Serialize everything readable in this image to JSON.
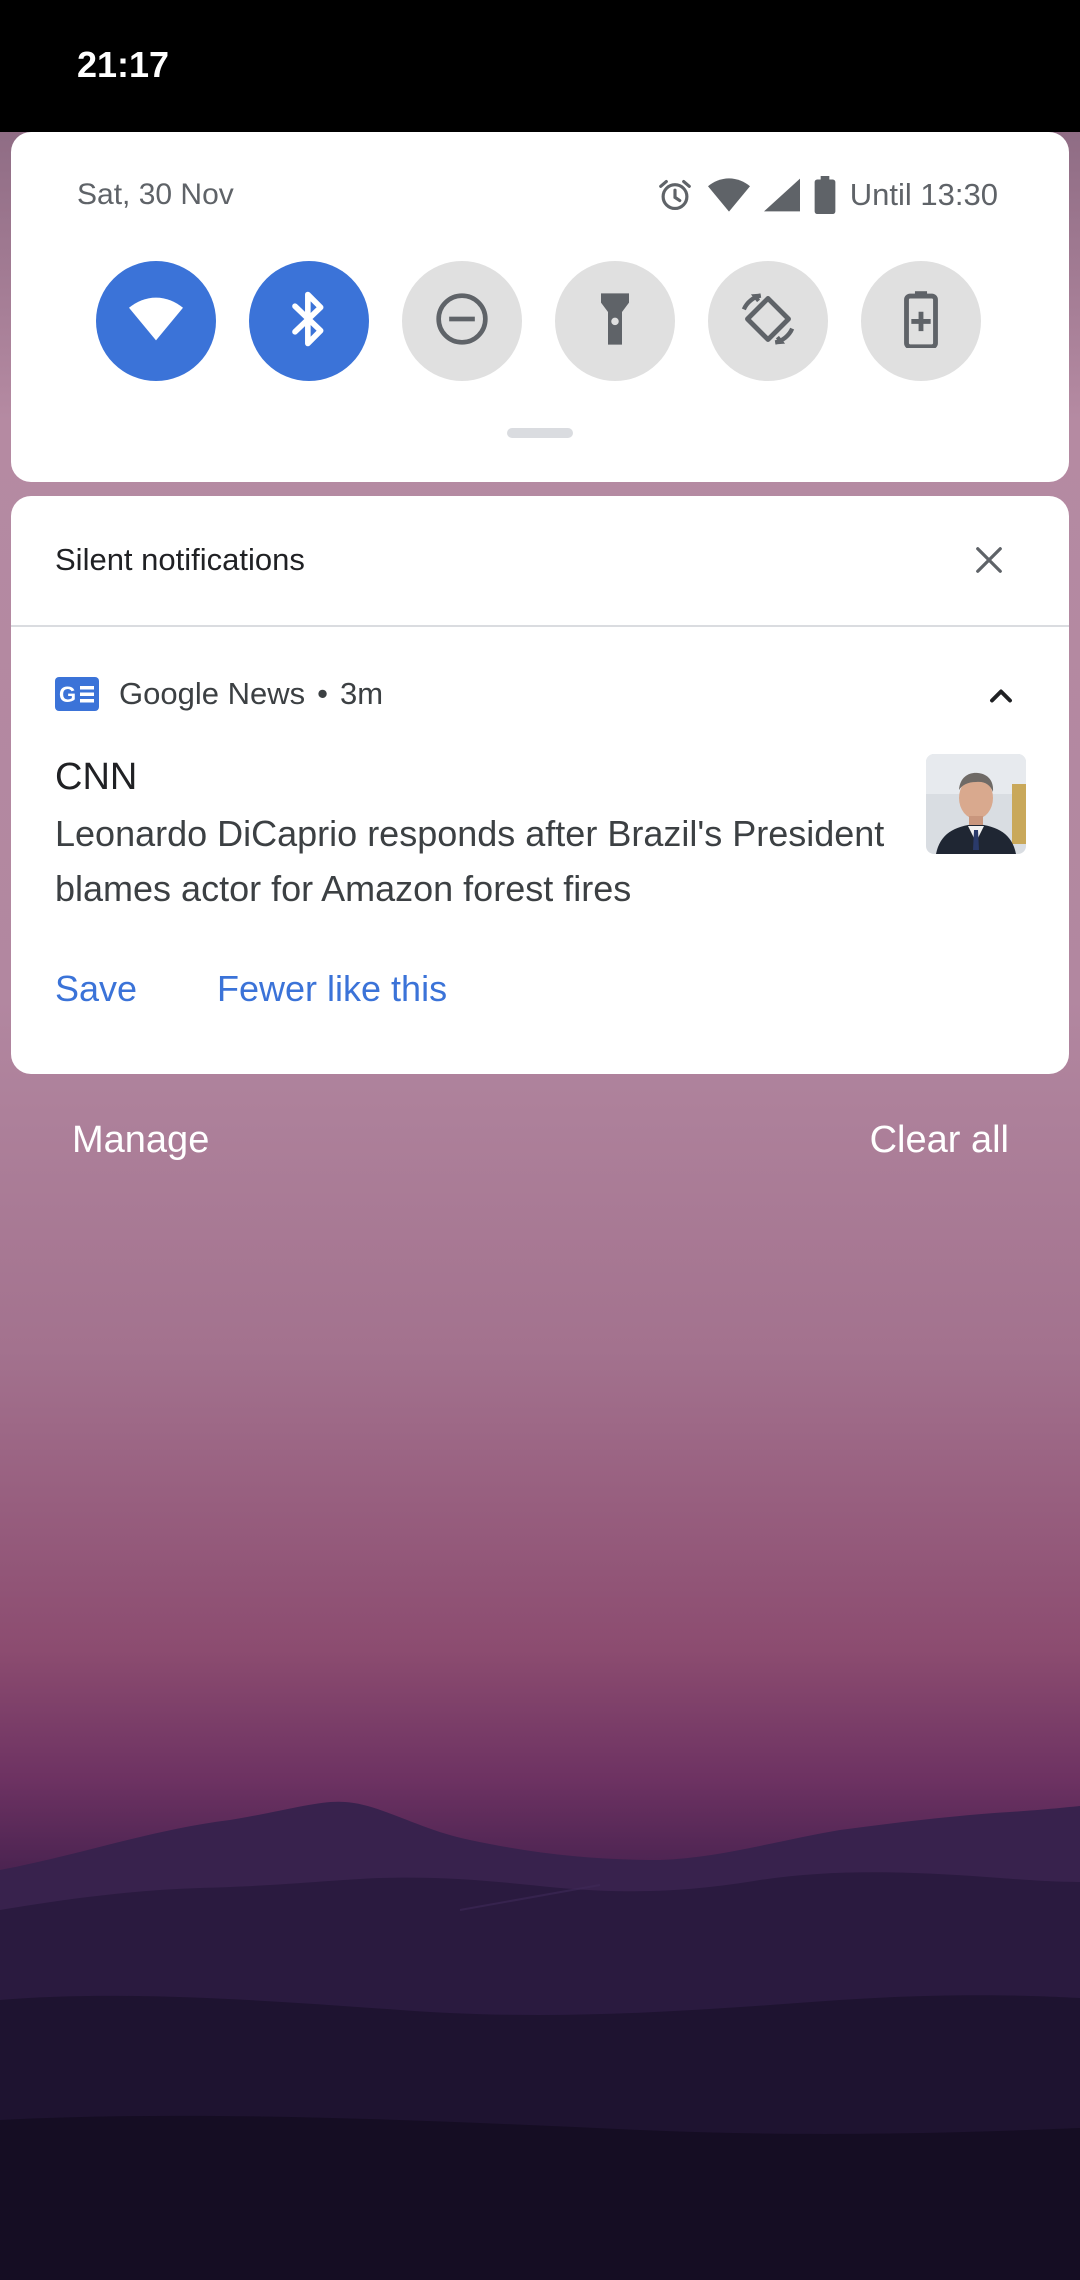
{
  "status_bar": {
    "time": "21:17"
  },
  "quick_settings": {
    "date": "Sat, 30 Nov",
    "battery_text": "Until 13:30",
    "tiles": [
      {
        "id": "wifi",
        "active": true
      },
      {
        "id": "bluetooth",
        "active": true
      },
      {
        "id": "do-not-disturb",
        "active": false
      },
      {
        "id": "flashlight",
        "active": false
      },
      {
        "id": "auto-rotate",
        "active": false
      },
      {
        "id": "battery-saver",
        "active": false
      }
    ]
  },
  "notifications": {
    "section_title": "Silent notifications",
    "items": [
      {
        "app_name": "Google News",
        "separator": "•",
        "time": "3m",
        "title": "CNN",
        "body": "Leonardo DiCaprio responds after Brazil's President blames actor for Amazon forest fires",
        "actions": [
          "Save",
          "Fewer like this"
        ]
      }
    ]
  },
  "footer": {
    "manage_label": "Manage",
    "clear_all_label": "Clear all"
  },
  "colors": {
    "accent": "#3b73d8",
    "tile_inactive": "#e0e0e0",
    "icon_gray": "#5f6368"
  }
}
